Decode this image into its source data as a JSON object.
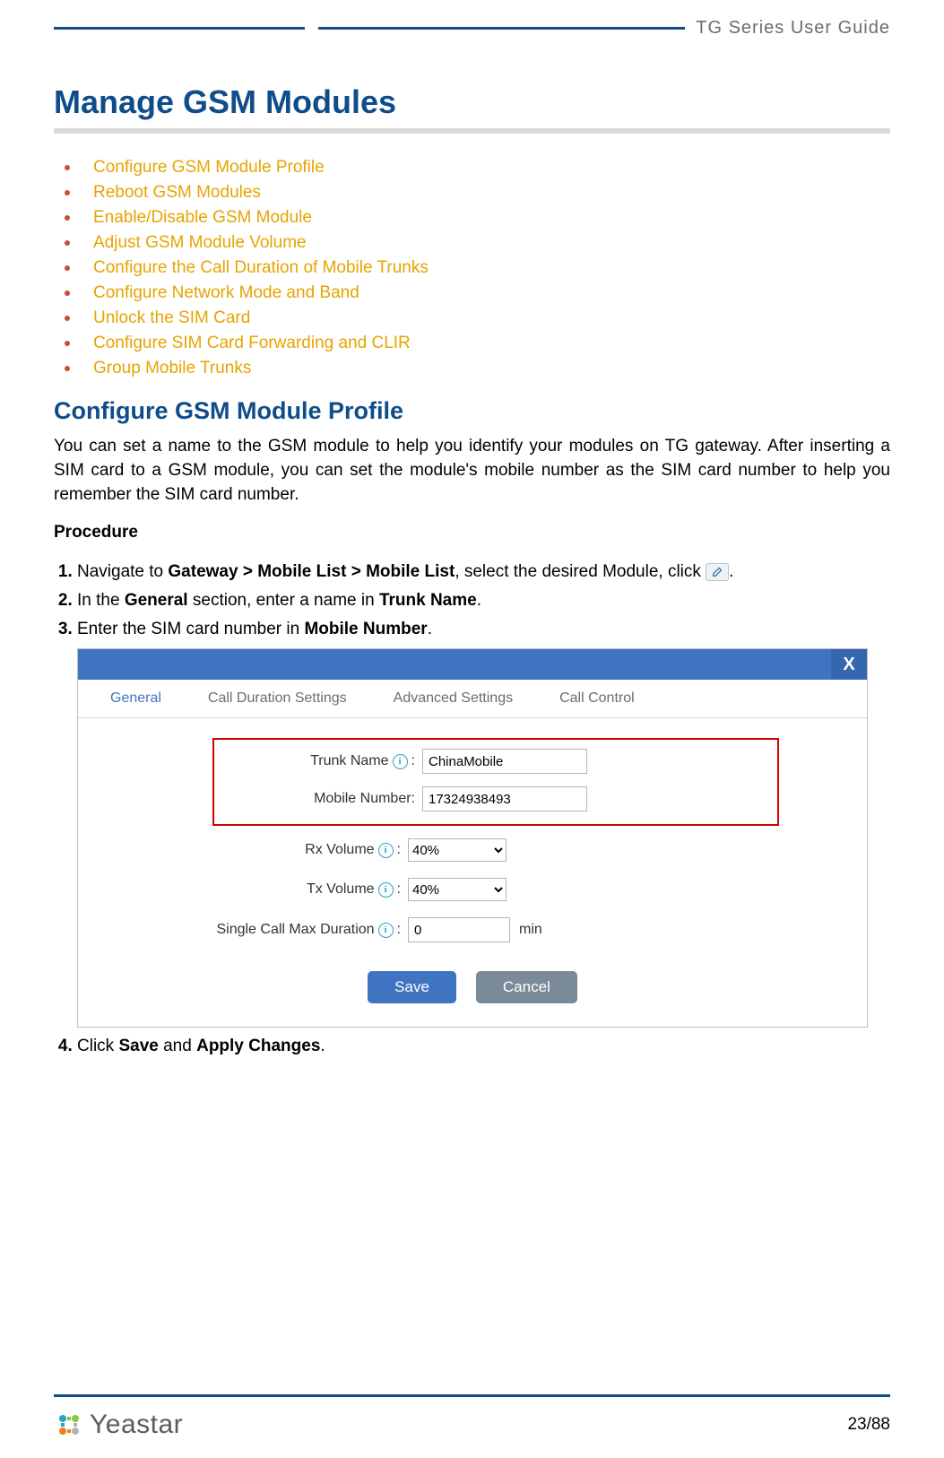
{
  "header": {
    "title": "TG  Series  User  Guide"
  },
  "h1": "Manage GSM Modules",
  "toc": [
    "Configure GSM Module Profile",
    "Reboot GSM Modules",
    "Enable/Disable GSM Module",
    "Adjust GSM Module Volume",
    "Configure the Call Duration of Mobile Trunks",
    "Configure Network Mode and Band",
    "Unlock the SIM Card",
    "Configure SIM Card Forwarding and CLIR",
    "Group Mobile Trunks"
  ],
  "h2": "Configure GSM Module Profile",
  "intro": "You can set a name to the GSM module to help you identify your modules on TG gateway. After inserting a SIM card to a GSM module, you can set the module's mobile number as the SIM card number to help you remember the SIM card number.",
  "procedure_label": "Procedure",
  "steps": {
    "s1a": "Navigate to ",
    "s1b": "Gateway > Mobile List > Mobile List",
    "s1c": ", select the desired Module, click ",
    "s1d": ".",
    "s2a": "In the ",
    "s2b": "General",
    "s2c": " section, enter a name in ",
    "s2d": "Trunk Name",
    "s2e": ".",
    "s3a": "Enter the SIM card number in ",
    "s3b": "Mobile Number",
    "s3c": ".",
    "s4a": "Click ",
    "s4b": "Save",
    "s4c": " and ",
    "s4d": "Apply Changes",
    "s4e": "."
  },
  "ui": {
    "close": "X",
    "tabs": {
      "general": "General",
      "call_duration": "Call Duration Settings",
      "advanced": "Advanced Settings",
      "call_control": "Call Control"
    },
    "labels": {
      "trunk_name": "Trunk Name",
      "mobile_number": "Mobile Number:",
      "rx_volume": "Rx Volume",
      "tx_volume": "Tx Volume",
      "single_call": "Single Call Max Duration",
      "colon": ":",
      "min": "min"
    },
    "values": {
      "trunk_name": "ChinaMobile",
      "mobile_number": "17324938493",
      "rx_volume": "40%",
      "tx_volume": "40%",
      "single_call": "0"
    },
    "buttons": {
      "save": "Save",
      "cancel": "Cancel"
    }
  },
  "footer": {
    "brand": "Yeastar",
    "page": "23/88"
  }
}
